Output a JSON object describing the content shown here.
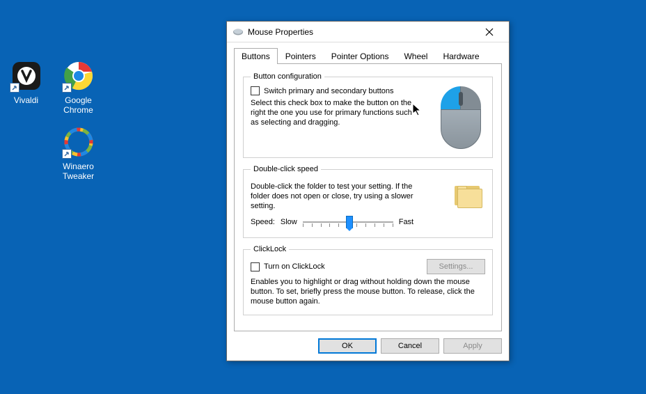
{
  "desktop": {
    "icons": [
      {
        "name": "vivaldi",
        "label": "Vivaldi",
        "col": 1,
        "row": 0
      },
      {
        "name": "chrome",
        "label": "Google\nChrome",
        "col": 2,
        "row": 0
      },
      {
        "name": "winaero",
        "label": "Winaero\nTweaker",
        "col": 2,
        "row": 1
      }
    ]
  },
  "dialog": {
    "title": "Mouse Properties",
    "tabs": [
      "Buttons",
      "Pointers",
      "Pointer Options",
      "Wheel",
      "Hardware"
    ],
    "active_tab": 0,
    "groups": {
      "button_config": {
        "legend": "Button configuration",
        "checkbox_label": "Switch primary and secondary buttons",
        "checked": false,
        "description": "Select this check box to make the button on the right the one you use for primary functions such as selecting and dragging."
      },
      "double_click": {
        "legend": "Double-click speed",
        "description": "Double-click the folder to test your setting. If the folder does not open or close, try using a slower setting.",
        "speed_label": "Speed:",
        "slow_label": "Slow",
        "fast_label": "Fast"
      },
      "click_lock": {
        "legend": "ClickLock",
        "checkbox_label": "Turn on ClickLock",
        "checked": false,
        "settings_btn": "Settings...",
        "description": "Enables you to highlight or drag without holding down the mouse button. To set, briefly press the mouse button. To release, click the mouse button again."
      }
    },
    "actions": {
      "ok": "OK",
      "cancel": "Cancel",
      "apply": "Apply"
    }
  }
}
